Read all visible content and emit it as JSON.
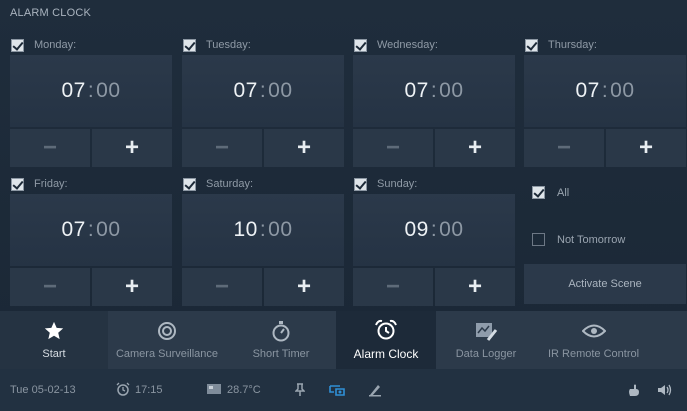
{
  "title": "ALARM CLOCK",
  "days": [
    {
      "label": "Monday:",
      "checked": true,
      "hh": "07",
      "mm": "00"
    },
    {
      "label": "Tuesday:",
      "checked": true,
      "hh": "07",
      "mm": "00"
    },
    {
      "label": "Wednesday:",
      "checked": true,
      "hh": "07",
      "mm": "00"
    },
    {
      "label": "Thursday:",
      "checked": true,
      "hh": "07",
      "mm": "00"
    },
    {
      "label": "Friday:",
      "checked": true,
      "hh": "07",
      "mm": "00"
    },
    {
      "label": "Saturday:",
      "checked": true,
      "hh": "10",
      "mm": "00"
    },
    {
      "label": "Sunday:",
      "checked": true,
      "hh": "09",
      "mm": "00"
    }
  ],
  "controls": {
    "separator": ":",
    "minus": "−",
    "plus": "+"
  },
  "options": {
    "all": {
      "label": "All",
      "checked": true
    },
    "not_tomorrow": {
      "label": "Not Tomorrow",
      "checked": false
    },
    "activate_label": "Activate Scene"
  },
  "nav": [
    {
      "label": "Start",
      "icon": "star-icon"
    },
    {
      "label": "Camera Surveillance",
      "icon": "camera-lens-icon"
    },
    {
      "label": "Short Timer",
      "icon": "stopwatch-icon"
    },
    {
      "label": "Alarm Clock",
      "icon": "alarm-clock-icon",
      "active": true
    },
    {
      "label": "Data Logger",
      "icon": "chart-pen-icon"
    },
    {
      "label": "IR Remote Control",
      "icon": "eye-icon"
    }
  ],
  "status": {
    "date": "Tue 05-02-13",
    "alarm_time": "17:15",
    "temperature": "28.7°C"
  },
  "colors": {
    "accent_blue": "#2f8fd6",
    "background": "#1c2a39"
  }
}
